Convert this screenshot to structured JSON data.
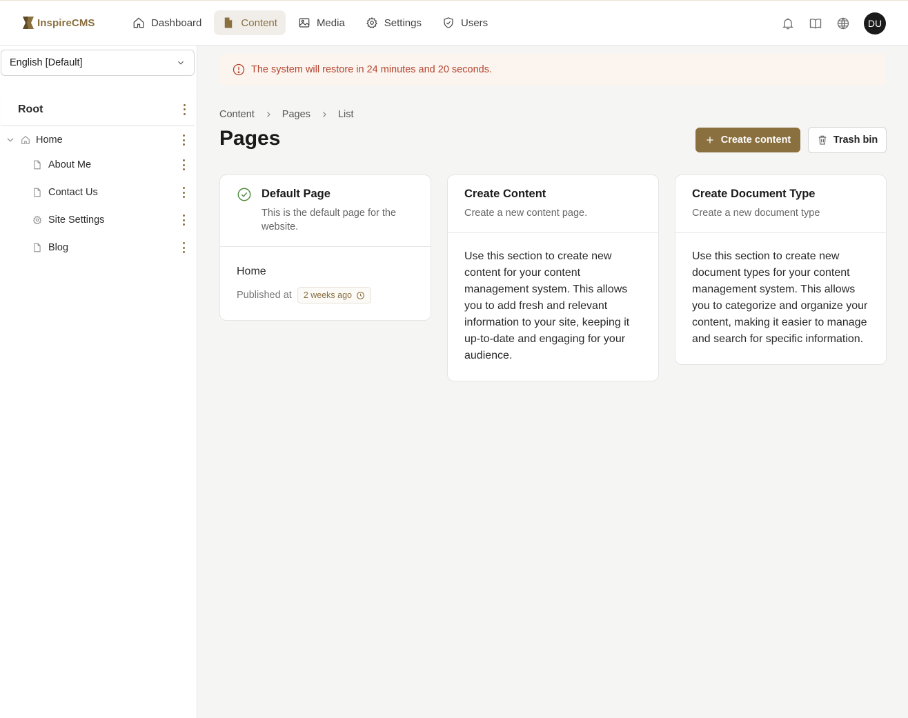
{
  "app": {
    "name": "InspireCMS"
  },
  "nav": {
    "items": [
      {
        "label": "Dashboard",
        "icon": "home-icon"
      },
      {
        "label": "Content",
        "icon": "document-icon",
        "active": true
      },
      {
        "label": "Media",
        "icon": "image-icon"
      },
      {
        "label": "Settings",
        "icon": "gear-icon"
      },
      {
        "label": "Users",
        "icon": "shield-check-icon"
      }
    ],
    "avatar_initials": "DU"
  },
  "sidebar": {
    "language": "English [Default]",
    "root_label": "Root",
    "tree": [
      {
        "label": "Home",
        "icon": "home-icon",
        "expanded": true
      },
      {
        "label": "About Me",
        "icon": "document-icon"
      },
      {
        "label": "Contact Us",
        "icon": "document-icon"
      },
      {
        "label": "Site Settings",
        "icon": "gear-icon"
      },
      {
        "label": "Blog",
        "icon": "document-icon"
      }
    ]
  },
  "alert": {
    "text": "The system will restore in 24 minutes and 20 seconds.",
    "color": "#b4452f"
  },
  "breadcrumb": [
    "Content",
    "Pages",
    "List"
  ],
  "page": {
    "title": "Pages",
    "create_button": "Create content",
    "trash_button": "Trash bin"
  },
  "cards": [
    {
      "title": "Default Page",
      "subtitle": "This is the default page for the website.",
      "item_label": "Home",
      "published_label": "Published at",
      "published_badge": "2 weeks ago"
    },
    {
      "title": "Create Content",
      "subtitle": "Create a new content page.",
      "body": "Use this section to create new content for your content management system. This allows you to add fresh and relevant information to your site, keeping it up-to-date and engaging for your audience."
    },
    {
      "title": "Create Document Type",
      "subtitle": "Create a new document type",
      "body": "Use this section to create new document types for your content management system. This allows you to categorize and organize your content, making it easier to manage and search for specific information."
    }
  ],
  "colors": {
    "brand": "#8a6f3f",
    "success": "#4f8a3d"
  }
}
